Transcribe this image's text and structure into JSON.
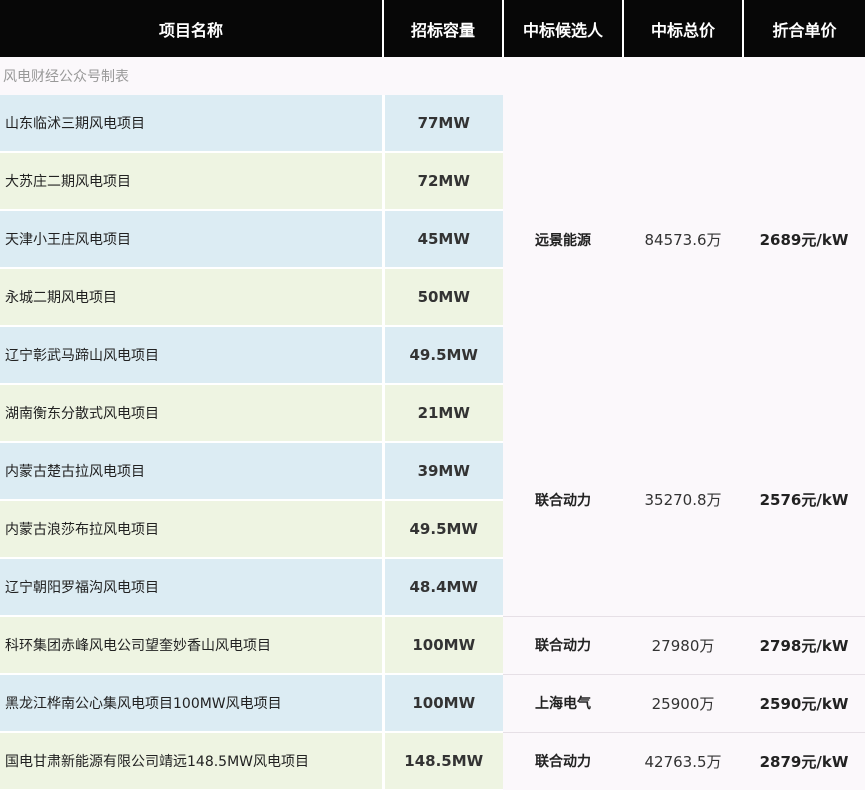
{
  "headers": [
    "项目名称",
    "招标容量",
    "中标候选人",
    "中标总价",
    "折合单价"
  ],
  "caption": "风电财经公众号制表",
  "groups": [
    {
      "winner": "远景能源",
      "total": "84573.6万",
      "unit_price": "2689元/kW",
      "projects": [
        {
          "name": "山东临沭三期风电项目",
          "capacity": "77MW"
        },
        {
          "name": "大苏庄二期风电项目",
          "capacity": "72MW"
        },
        {
          "name": "天津小王庄风电项目",
          "capacity": "45MW"
        },
        {
          "name": "永城二期风电项目",
          "capacity": "50MW"
        },
        {
          "name": "辽宁彰武马蹄山风电项目",
          "capacity": "49.5MW"
        }
      ]
    },
    {
      "winner": "联合动力",
      "total": "35270.8万",
      "unit_price": "2576元/kW",
      "projects": [
        {
          "name": "湖南衡东分散式风电项目",
          "capacity": "21MW"
        },
        {
          "name": "内蒙古楚古拉风电项目",
          "capacity": "39MW"
        },
        {
          "name": "内蒙古浪莎布拉风电项目",
          "capacity": "49.5MW"
        },
        {
          "name": "辽宁朝阳罗福沟风电项目",
          "capacity": "48.4MW"
        }
      ]
    },
    {
      "winner": "联合动力",
      "total": "27980万",
      "unit_price": "2798元/kW",
      "projects": [
        {
          "name": "科环集团赤峰风电公司望奎妙香山风电项目",
          "capacity": "100MW"
        }
      ]
    },
    {
      "winner": "上海电气",
      "total": "25900万",
      "unit_price": "2590元/kW",
      "projects": [
        {
          "name": "黑龙江桦南公心集风电项目100MW风电项目",
          "capacity": "100MW"
        }
      ]
    },
    {
      "winner": "联合动力",
      "total": "42763.5万",
      "unit_price": "2879元/kW",
      "projects": [
        {
          "name": "国电甘肃新能源有限公司靖远148.5MW风电项目",
          "capacity": "148.5MW"
        }
      ]
    }
  ]
}
